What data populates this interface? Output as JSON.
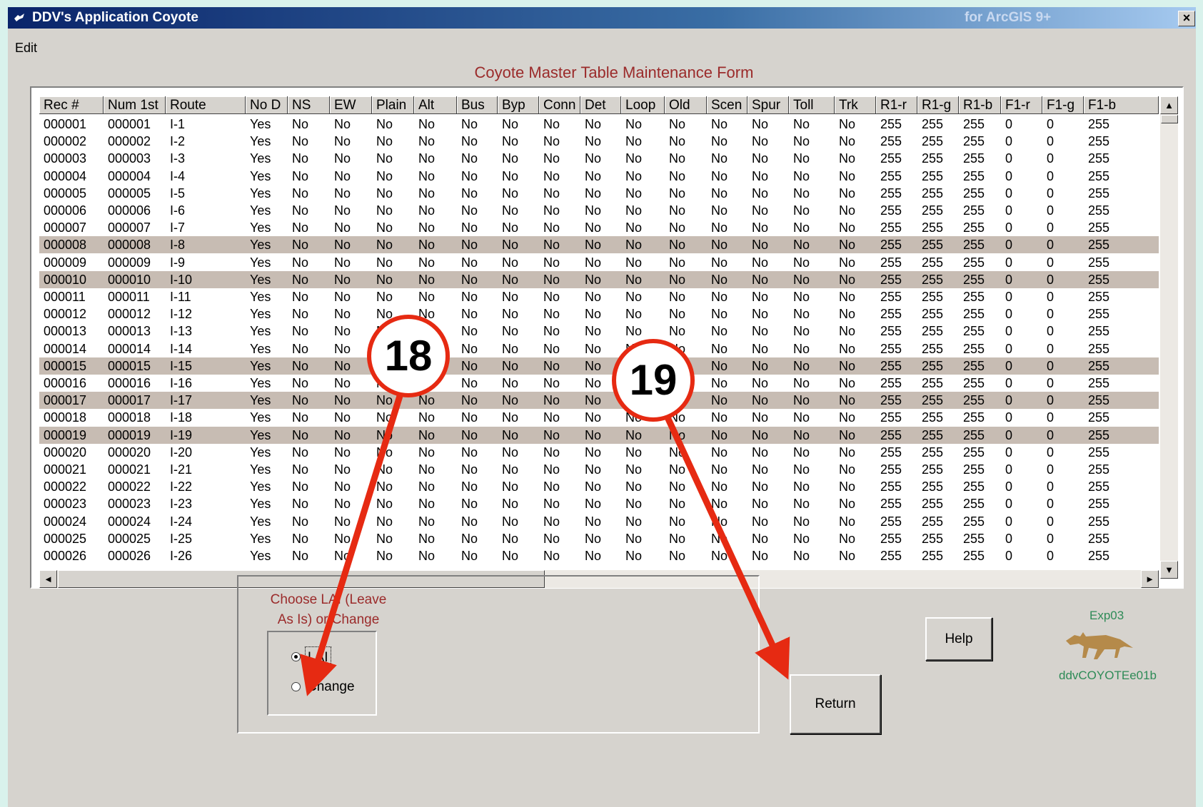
{
  "window": {
    "title": "DDV's Application Coyote",
    "title_right": "for ArcGIS 9+",
    "close_glyph": "×"
  },
  "menu": {
    "edit": "Edit"
  },
  "form_title": "Coyote Master Table Maintenance Form",
  "grid": {
    "columns": [
      "Rec #",
      "Num 1st",
      "Route",
      "No D",
      "NS",
      "EW",
      "Plain",
      "Alt",
      "Bus",
      "Byp",
      "Conn",
      "Det",
      "Loop",
      "Old",
      "Scen",
      "Spur",
      "Toll",
      "Trk",
      "R1-r",
      "R1-g",
      "R1-b",
      "F1-r",
      "F1-g",
      "F1-b"
    ],
    "rows": [
      [
        "000001",
        "000001",
        "I-1",
        "Yes",
        "No",
        "No",
        "No",
        "No",
        "No",
        "No",
        "No",
        "No",
        "No",
        "No",
        "No",
        "No",
        "No",
        "No",
        "255",
        "255",
        "255",
        "0",
        "0",
        "255"
      ],
      [
        "000002",
        "000002",
        "I-2",
        "Yes",
        "No",
        "No",
        "No",
        "No",
        "No",
        "No",
        "No",
        "No",
        "No",
        "No",
        "No",
        "No",
        "No",
        "No",
        "255",
        "255",
        "255",
        "0",
        "0",
        "255"
      ],
      [
        "000003",
        "000003",
        "I-3",
        "Yes",
        "No",
        "No",
        "No",
        "No",
        "No",
        "No",
        "No",
        "No",
        "No",
        "No",
        "No",
        "No",
        "No",
        "No",
        "255",
        "255",
        "255",
        "0",
        "0",
        "255"
      ],
      [
        "000004",
        "000004",
        "I-4",
        "Yes",
        "No",
        "No",
        "No",
        "No",
        "No",
        "No",
        "No",
        "No",
        "No",
        "No",
        "No",
        "No",
        "No",
        "No",
        "255",
        "255",
        "255",
        "0",
        "0",
        "255"
      ],
      [
        "000005",
        "000005",
        "I-5",
        "Yes",
        "No",
        "No",
        "No",
        "No",
        "No",
        "No",
        "No",
        "No",
        "No",
        "No",
        "No",
        "No",
        "No",
        "No",
        "255",
        "255",
        "255",
        "0",
        "0",
        "255"
      ],
      [
        "000006",
        "000006",
        "I-6",
        "Yes",
        "No",
        "No",
        "No",
        "No",
        "No",
        "No",
        "No",
        "No",
        "No",
        "No",
        "No",
        "No",
        "No",
        "No",
        "255",
        "255",
        "255",
        "0",
        "0",
        "255"
      ],
      [
        "000007",
        "000007",
        "I-7",
        "Yes",
        "No",
        "No",
        "No",
        "No",
        "No",
        "No",
        "No",
        "No",
        "No",
        "No",
        "No",
        "No",
        "No",
        "No",
        "255",
        "255",
        "255",
        "0",
        "0",
        "255"
      ],
      [
        "000008",
        "000008",
        "I-8",
        "Yes",
        "No",
        "No",
        "No",
        "No",
        "No",
        "No",
        "No",
        "No",
        "No",
        "No",
        "No",
        "No",
        "No",
        "No",
        "255",
        "255",
        "255",
        "0",
        "0",
        "255"
      ],
      [
        "000009",
        "000009",
        "I-9",
        "Yes",
        "No",
        "No",
        "No",
        "No",
        "No",
        "No",
        "No",
        "No",
        "No",
        "No",
        "No",
        "No",
        "No",
        "No",
        "255",
        "255",
        "255",
        "0",
        "0",
        "255"
      ],
      [
        "000010",
        "000010",
        "I-10",
        "Yes",
        "No",
        "No",
        "No",
        "No",
        "No",
        "No",
        "No",
        "No",
        "No",
        "No",
        "No",
        "No",
        "No",
        "No",
        "255",
        "255",
        "255",
        "0",
        "0",
        "255"
      ],
      [
        "000011",
        "000011",
        "I-11",
        "Yes",
        "No",
        "No",
        "No",
        "No",
        "No",
        "No",
        "No",
        "No",
        "No",
        "No",
        "No",
        "No",
        "No",
        "No",
        "255",
        "255",
        "255",
        "0",
        "0",
        "255"
      ],
      [
        "000012",
        "000012",
        "I-12",
        "Yes",
        "No",
        "No",
        "No",
        "No",
        "No",
        "No",
        "No",
        "No",
        "No",
        "No",
        "No",
        "No",
        "No",
        "No",
        "255",
        "255",
        "255",
        "0",
        "0",
        "255"
      ],
      [
        "000013",
        "000013",
        "I-13",
        "Yes",
        "No",
        "No",
        "No",
        "No",
        "No",
        "No",
        "No",
        "No",
        "No",
        "No",
        "No",
        "No",
        "No",
        "No",
        "255",
        "255",
        "255",
        "0",
        "0",
        "255"
      ],
      [
        "000014",
        "000014",
        "I-14",
        "Yes",
        "No",
        "No",
        "No",
        "No",
        "No",
        "No",
        "No",
        "No",
        "No",
        "No",
        "No",
        "No",
        "No",
        "No",
        "255",
        "255",
        "255",
        "0",
        "0",
        "255"
      ],
      [
        "000015",
        "000015",
        "I-15",
        "Yes",
        "No",
        "No",
        "No",
        "No",
        "No",
        "No",
        "No",
        "No",
        "No",
        "No",
        "No",
        "No",
        "No",
        "No",
        "255",
        "255",
        "255",
        "0",
        "0",
        "255"
      ],
      [
        "000016",
        "000016",
        "I-16",
        "Yes",
        "No",
        "No",
        "No",
        "No",
        "No",
        "No",
        "No",
        "No",
        "No",
        "No",
        "No",
        "No",
        "No",
        "No",
        "255",
        "255",
        "255",
        "0",
        "0",
        "255"
      ],
      [
        "000017",
        "000017",
        "I-17",
        "Yes",
        "No",
        "No",
        "No",
        "No",
        "No",
        "No",
        "No",
        "No",
        "No",
        "No",
        "No",
        "No",
        "No",
        "No",
        "255",
        "255",
        "255",
        "0",
        "0",
        "255"
      ],
      [
        "000018",
        "000018",
        "I-18",
        "Yes",
        "No",
        "No",
        "No",
        "No",
        "No",
        "No",
        "No",
        "No",
        "No",
        "No",
        "No",
        "No",
        "No",
        "No",
        "255",
        "255",
        "255",
        "0",
        "0",
        "255"
      ],
      [
        "000019",
        "000019",
        "I-19",
        "Yes",
        "No",
        "No",
        "No",
        "No",
        "No",
        "No",
        "No",
        "No",
        "No",
        "No",
        "No",
        "No",
        "No",
        "No",
        "255",
        "255",
        "255",
        "0",
        "0",
        "255"
      ],
      [
        "000020",
        "000020",
        "I-20",
        "Yes",
        "No",
        "No",
        "No",
        "No",
        "No",
        "No",
        "No",
        "No",
        "No",
        "No",
        "No",
        "No",
        "No",
        "No",
        "255",
        "255",
        "255",
        "0",
        "0",
        "255"
      ],
      [
        "000021",
        "000021",
        "I-21",
        "Yes",
        "No",
        "No",
        "No",
        "No",
        "No",
        "No",
        "No",
        "No",
        "No",
        "No",
        "No",
        "No",
        "No",
        "No",
        "255",
        "255",
        "255",
        "0",
        "0",
        "255"
      ],
      [
        "000022",
        "000022",
        "I-22",
        "Yes",
        "No",
        "No",
        "No",
        "No",
        "No",
        "No",
        "No",
        "No",
        "No",
        "No",
        "No",
        "No",
        "No",
        "No",
        "255",
        "255",
        "255",
        "0",
        "0",
        "255"
      ],
      [
        "000023",
        "000023",
        "I-23",
        "Yes",
        "No",
        "No",
        "No",
        "No",
        "No",
        "No",
        "No",
        "No",
        "No",
        "No",
        "No",
        "No",
        "No",
        "No",
        "255",
        "255",
        "255",
        "0",
        "0",
        "255"
      ],
      [
        "000024",
        "000024",
        "I-24",
        "Yes",
        "No",
        "No",
        "No",
        "No",
        "No",
        "No",
        "No",
        "No",
        "No",
        "No",
        "No",
        "No",
        "No",
        "No",
        "255",
        "255",
        "255",
        "0",
        "0",
        "255"
      ],
      [
        "000025",
        "000025",
        "I-25",
        "Yes",
        "No",
        "No",
        "No",
        "No",
        "No",
        "No",
        "No",
        "No",
        "No",
        "No",
        "No",
        "No",
        "No",
        "No",
        "255",
        "255",
        "255",
        "0",
        "0",
        "255"
      ],
      [
        "000026",
        "000026",
        "I-26",
        "Yes",
        "No",
        "No",
        "No",
        "No",
        "No",
        "No",
        "No",
        "No",
        "No",
        "No",
        "No",
        "No",
        "No",
        "No",
        "255",
        "255",
        "255",
        "0",
        "0",
        "255"
      ]
    ],
    "highlighted_rows": [
      "000008",
      "000010",
      "000015",
      "000017",
      "000019"
    ],
    "highlight_color": "#c7bcb3",
    "scroll_up_glyph": "▲",
    "scroll_down_glyph": "▼",
    "scroll_left_glyph": "◄",
    "scroll_right_glyph": "►"
  },
  "options": {
    "caption_line1": "Choose LAI (Leave",
    "caption_line2": "As Is) or Change",
    "lai_label": "LAI",
    "change_label": "Change",
    "selected": "LAI"
  },
  "buttons": {
    "help": "Help",
    "return": "Return"
  },
  "brand": {
    "exp": "Exp03",
    "code": "ddvCOYOTEe01b",
    "logo_icon": "coyote-icon"
  },
  "callouts": {
    "first": "18",
    "second": "19",
    "color": "#e62a12"
  },
  "colors": {
    "title_bar": "#0a246a",
    "face": "#d6d3ce",
    "caption_red": "#9b2b2b",
    "brand_green": "#2e8b57"
  }
}
